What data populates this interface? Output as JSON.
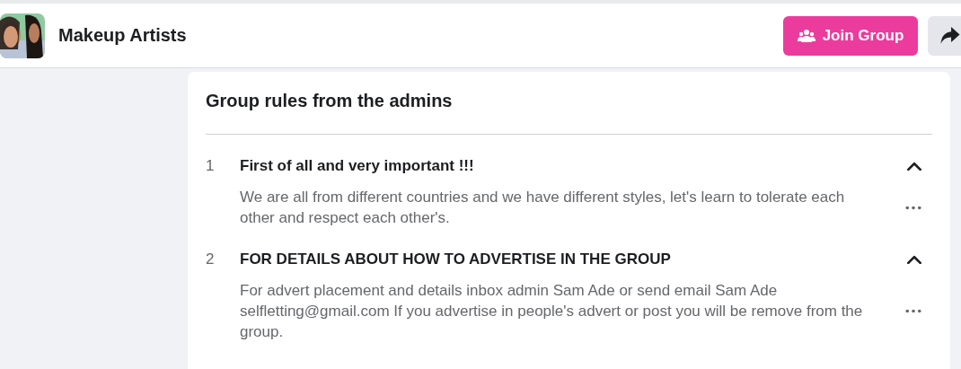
{
  "group": {
    "name": "Makeup Artists",
    "join_button": "Join Group"
  },
  "rules_card": {
    "title": "Group rules from the admins",
    "rules": [
      {
        "number": "1",
        "title": "First of all and very important !!!",
        "body": "We are all from different countries and we have different styles, let's learn to tolerate each other and respect each other's.",
        "expanded": true
      },
      {
        "number": "2",
        "title": "FOR DETAILS ABOUT HOW TO ADVERTISE IN THE GROUP",
        "body": "For advert placement and details inbox admin Sam Ade or send email Sam Ade selfletting@gmail.com If you advertise in people's advert or post you will be remove from the group.",
        "expanded": true
      }
    ]
  }
}
